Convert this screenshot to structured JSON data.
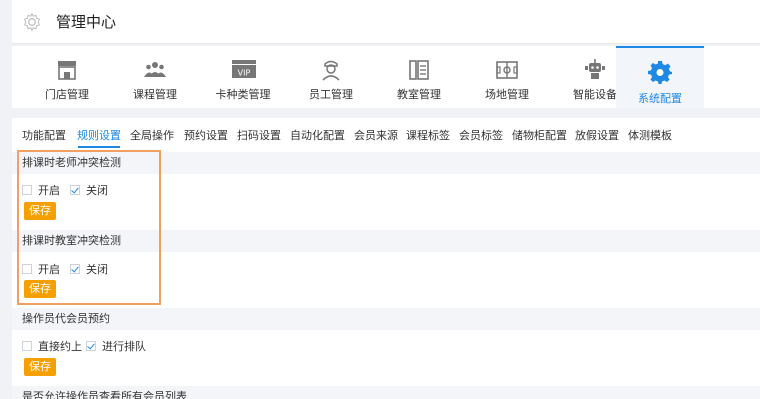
{
  "header": {
    "title": "管理中心"
  },
  "nav": [
    {
      "label": "门店管理",
      "icon": "store-icon"
    },
    {
      "label": "课程管理",
      "icon": "people-icon"
    },
    {
      "label": "卡种类管理",
      "icon": "vip-card-icon"
    },
    {
      "label": "员工管理",
      "icon": "staff-icon"
    },
    {
      "label": "教室管理",
      "icon": "building-icon"
    },
    {
      "label": "场地管理",
      "icon": "venue-icon"
    },
    {
      "label": "智能设备",
      "icon": "robot-icon"
    },
    {
      "label": "系统配置",
      "icon": "settings-gear-icon",
      "active": true
    }
  ],
  "tabs": [
    {
      "label": "功能配置"
    },
    {
      "label": "规则设置",
      "active": true
    },
    {
      "label": "全局操作"
    },
    {
      "label": "预约设置"
    },
    {
      "label": "扫码设置"
    },
    {
      "label": "自动化配置"
    },
    {
      "label": "会员来源"
    },
    {
      "label": "课程标签"
    },
    {
      "label": "会员标签"
    },
    {
      "label": "储物柜配置"
    },
    {
      "label": "放假设置"
    },
    {
      "label": "体测模板"
    }
  ],
  "sections": [
    {
      "title": "排课时老师冲突检测",
      "options": [
        {
          "label": "开启",
          "checked": false
        },
        {
          "label": "关闭",
          "checked": true
        }
      ],
      "save_label": "保存"
    },
    {
      "title": "排课时教室冲突检测",
      "options": [
        {
          "label": "开启",
          "checked": false
        },
        {
          "label": "关闭",
          "checked": true
        }
      ],
      "save_label": "保存"
    },
    {
      "title": "操作员代会员预约",
      "options": [
        {
          "label": "直接约上",
          "checked": false
        },
        {
          "label": "进行排队",
          "checked": true
        }
      ],
      "save_label": "保存"
    },
    {
      "title": "是否允许操作员查看所有会员列表"
    }
  ],
  "colors": {
    "accent": "#1e88e5",
    "save_button": "#f5a000",
    "highlight_border": "#f0a060"
  }
}
